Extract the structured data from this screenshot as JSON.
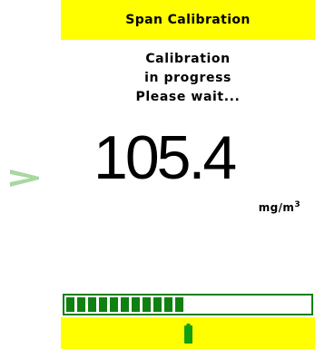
{
  "screen": {
    "title": "Span Calibration",
    "message_lines": [
      "Calibration",
      "in progress",
      "Please wait..."
    ],
    "reading": "105.4",
    "unit_base": "mg/m",
    "unit_exponent": "3",
    "progress_fraction": 0.5
  },
  "icons": {
    "arrow": "chevron-right-icon",
    "battery": "battery-icon"
  },
  "colors": {
    "title_bar": "#ffff00",
    "footer_bar": "#ffff00",
    "progress": "#108010",
    "battery": "#10a010",
    "arrow": "#a8d8a0"
  }
}
